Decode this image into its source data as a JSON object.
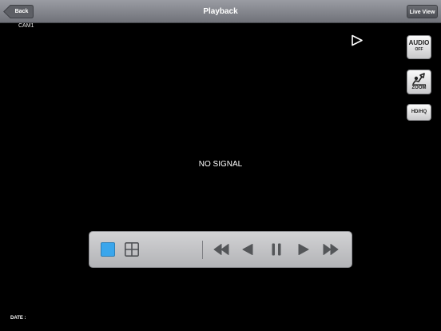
{
  "navbar": {
    "title": "Playback",
    "back_label": "Back",
    "live_view_label": "Live View"
  },
  "video": {
    "camera_label": "CAM1",
    "status_text": "NO SIGNAL",
    "date_label": "DATE :"
  },
  "side_tools": {
    "audio_label": "AUDIO",
    "audio_state": "OFF",
    "zoom_label": "ZOOM",
    "quality_label": "HD/HQ"
  },
  "controls": {
    "layout_options": [
      "single-view",
      "quad-view"
    ],
    "selected_layout": "single-view",
    "playback_buttons": [
      "rewind",
      "step-back",
      "pause",
      "step-forward",
      "fast-forward"
    ]
  },
  "colors": {
    "navbar": "#808288",
    "background": "#000000",
    "selected_layout": "#3aa6ec",
    "control_icon": "#545659"
  }
}
